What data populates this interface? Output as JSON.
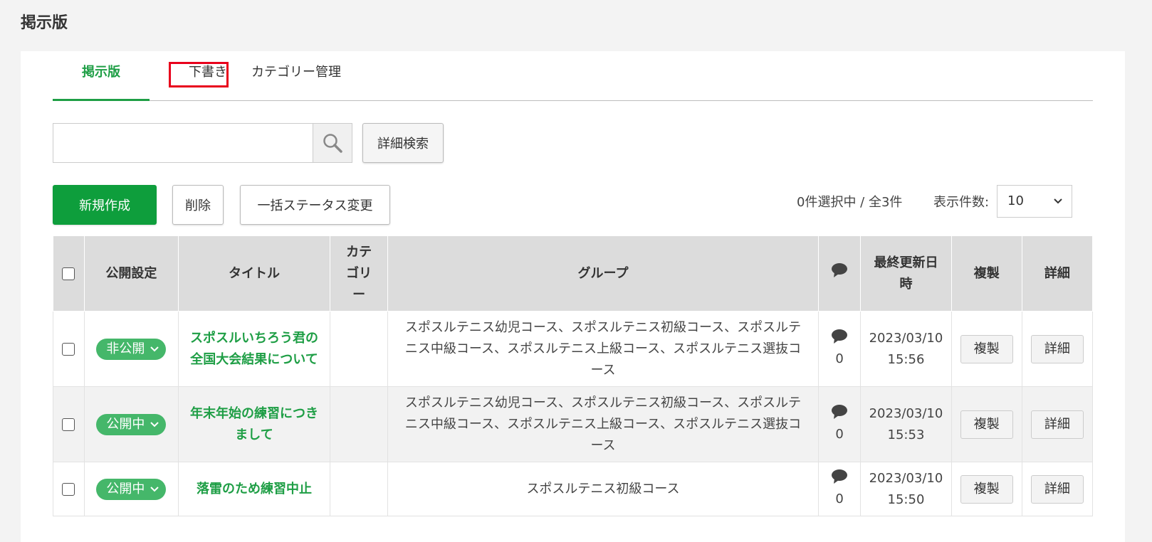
{
  "page_title": "掲示版",
  "tabs": [
    {
      "label": "掲示版",
      "active": true
    },
    {
      "label": "下書き",
      "active": false
    },
    {
      "label": "カテゴリー管理",
      "active": false
    }
  ],
  "search": {
    "placeholder": "",
    "value": "",
    "advanced_label": "詳細検索"
  },
  "toolbar": {
    "new_label": "新規作成",
    "delete_label": "削除",
    "bulk_status_label": "一括ステータス変更",
    "count_text": "0件選択中 / 全3件",
    "per_page_label": "表示件数:",
    "per_page_value": "10"
  },
  "table": {
    "headers": {
      "status": "公開設定",
      "title": "タイトル",
      "category": "カテゴリー",
      "group": "グループ",
      "updated": "最終更新日時",
      "duplicate": "複製",
      "detail": "詳細"
    },
    "rows": [
      {
        "status": "非公開",
        "title": "スポスルいちろう君の全国大会結果について",
        "category": "",
        "group": "スポスルテニス幼児コース、スポスルテニス初級コース、スポスルテニス中級コース、スポスルテニス上級コース、スポスルテニス選抜コース",
        "comments": "0",
        "updated": "2023/03/10 15:56",
        "duplicate": "複製",
        "detail": "詳細"
      },
      {
        "status": "公開中",
        "title": "年末年始の練習につきまして",
        "category": "",
        "group": "スポスルテニス幼児コース、スポスルテニス初級コース、スポスルテニス中級コース、スポスルテニス上級コース、スポスルテニス選抜コース",
        "comments": "0",
        "updated": "2023/03/10 15:53",
        "duplicate": "複製",
        "detail": "詳細"
      },
      {
        "status": "公開中",
        "title": "落雷のため練習中止",
        "category": "",
        "group": "スポスルテニス初級コース",
        "comments": "0",
        "updated": "2023/03/10 15:50",
        "duplicate": "複製",
        "detail": "詳細"
      }
    ]
  },
  "colors": {
    "accent": "#0e9e3c",
    "status_pill": "#45b76a",
    "highlight_box": "#e8001c"
  },
  "icons": {
    "search": "search-icon",
    "comment": "comment-icon",
    "chevron": "chevron-down-icon"
  }
}
